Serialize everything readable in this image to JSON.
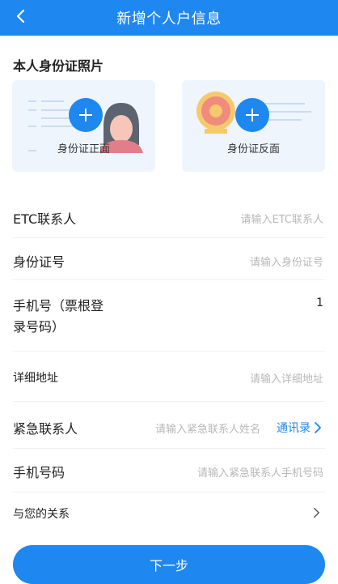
{
  "header": {
    "title": "新增个人户信息"
  },
  "id_section": {
    "title": "本人身份证照片",
    "front_label": "身份证正面",
    "back_label": "身份证反面"
  },
  "form": {
    "etc_contact": {
      "label": "ETC联系人",
      "placeholder": "请输入ETC联系人"
    },
    "id_number": {
      "label": "身份证号",
      "placeholder": "请输入身份证号"
    },
    "phone": {
      "label_line1": "手机号（票根登",
      "label_line2": "录号码）",
      "value": "1"
    },
    "address": {
      "label": "详细地址",
      "placeholder": "请输入详细地址"
    },
    "emergency_contact": {
      "label": "紧急联系人",
      "placeholder": "请输入紧急联系人姓名",
      "link": "通讯录"
    },
    "emergency_phone": {
      "label": "手机号码",
      "placeholder": "请输入紧急联系人手机号码"
    },
    "relationship": {
      "label": "与您的关系"
    }
  },
  "footer": {
    "next_label": "下一步"
  },
  "colors": {
    "primary": "#1e87f0",
    "placeholder": "#b8b8b8"
  }
}
